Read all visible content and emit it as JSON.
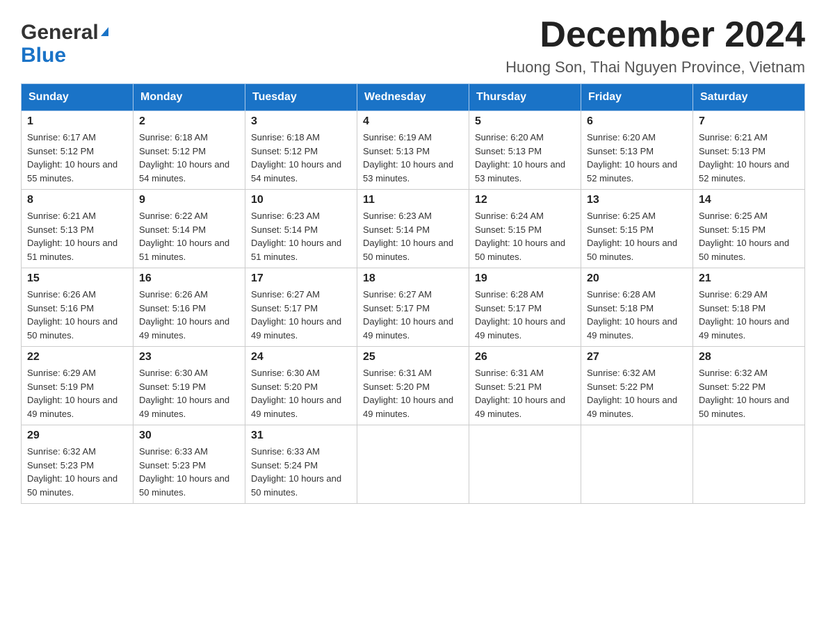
{
  "header": {
    "logo_general": "General",
    "logo_blue": "Blue",
    "month_title": "December 2024",
    "location": "Huong Son, Thai Nguyen Province, Vietnam"
  },
  "weekdays": [
    "Sunday",
    "Monday",
    "Tuesday",
    "Wednesday",
    "Thursday",
    "Friday",
    "Saturday"
  ],
  "weeks": [
    [
      {
        "day": "1",
        "sunrise": "6:17 AM",
        "sunset": "5:12 PM",
        "daylight": "10 hours and 55 minutes."
      },
      {
        "day": "2",
        "sunrise": "6:18 AM",
        "sunset": "5:12 PM",
        "daylight": "10 hours and 54 minutes."
      },
      {
        "day": "3",
        "sunrise": "6:18 AM",
        "sunset": "5:12 PM",
        "daylight": "10 hours and 54 minutes."
      },
      {
        "day": "4",
        "sunrise": "6:19 AM",
        "sunset": "5:13 PM",
        "daylight": "10 hours and 53 minutes."
      },
      {
        "day": "5",
        "sunrise": "6:20 AM",
        "sunset": "5:13 PM",
        "daylight": "10 hours and 53 minutes."
      },
      {
        "day": "6",
        "sunrise": "6:20 AM",
        "sunset": "5:13 PM",
        "daylight": "10 hours and 52 minutes."
      },
      {
        "day": "7",
        "sunrise": "6:21 AM",
        "sunset": "5:13 PM",
        "daylight": "10 hours and 52 minutes."
      }
    ],
    [
      {
        "day": "8",
        "sunrise": "6:21 AM",
        "sunset": "5:13 PM",
        "daylight": "10 hours and 51 minutes."
      },
      {
        "day": "9",
        "sunrise": "6:22 AM",
        "sunset": "5:14 PM",
        "daylight": "10 hours and 51 minutes."
      },
      {
        "day": "10",
        "sunrise": "6:23 AM",
        "sunset": "5:14 PM",
        "daylight": "10 hours and 51 minutes."
      },
      {
        "day": "11",
        "sunrise": "6:23 AM",
        "sunset": "5:14 PM",
        "daylight": "10 hours and 50 minutes."
      },
      {
        "day": "12",
        "sunrise": "6:24 AM",
        "sunset": "5:15 PM",
        "daylight": "10 hours and 50 minutes."
      },
      {
        "day": "13",
        "sunrise": "6:25 AM",
        "sunset": "5:15 PM",
        "daylight": "10 hours and 50 minutes."
      },
      {
        "day": "14",
        "sunrise": "6:25 AM",
        "sunset": "5:15 PM",
        "daylight": "10 hours and 50 minutes."
      }
    ],
    [
      {
        "day": "15",
        "sunrise": "6:26 AM",
        "sunset": "5:16 PM",
        "daylight": "10 hours and 50 minutes."
      },
      {
        "day": "16",
        "sunrise": "6:26 AM",
        "sunset": "5:16 PM",
        "daylight": "10 hours and 49 minutes."
      },
      {
        "day": "17",
        "sunrise": "6:27 AM",
        "sunset": "5:17 PM",
        "daylight": "10 hours and 49 minutes."
      },
      {
        "day": "18",
        "sunrise": "6:27 AM",
        "sunset": "5:17 PM",
        "daylight": "10 hours and 49 minutes."
      },
      {
        "day": "19",
        "sunrise": "6:28 AM",
        "sunset": "5:17 PM",
        "daylight": "10 hours and 49 minutes."
      },
      {
        "day": "20",
        "sunrise": "6:28 AM",
        "sunset": "5:18 PM",
        "daylight": "10 hours and 49 minutes."
      },
      {
        "day": "21",
        "sunrise": "6:29 AM",
        "sunset": "5:18 PM",
        "daylight": "10 hours and 49 minutes."
      }
    ],
    [
      {
        "day": "22",
        "sunrise": "6:29 AM",
        "sunset": "5:19 PM",
        "daylight": "10 hours and 49 minutes."
      },
      {
        "day": "23",
        "sunrise": "6:30 AM",
        "sunset": "5:19 PM",
        "daylight": "10 hours and 49 minutes."
      },
      {
        "day": "24",
        "sunrise": "6:30 AM",
        "sunset": "5:20 PM",
        "daylight": "10 hours and 49 minutes."
      },
      {
        "day": "25",
        "sunrise": "6:31 AM",
        "sunset": "5:20 PM",
        "daylight": "10 hours and 49 minutes."
      },
      {
        "day": "26",
        "sunrise": "6:31 AM",
        "sunset": "5:21 PM",
        "daylight": "10 hours and 49 minutes."
      },
      {
        "day": "27",
        "sunrise": "6:32 AM",
        "sunset": "5:22 PM",
        "daylight": "10 hours and 49 minutes."
      },
      {
        "day": "28",
        "sunrise": "6:32 AM",
        "sunset": "5:22 PM",
        "daylight": "10 hours and 50 minutes."
      }
    ],
    [
      {
        "day": "29",
        "sunrise": "6:32 AM",
        "sunset": "5:23 PM",
        "daylight": "10 hours and 50 minutes."
      },
      {
        "day": "30",
        "sunrise": "6:33 AM",
        "sunset": "5:23 PM",
        "daylight": "10 hours and 50 minutes."
      },
      {
        "day": "31",
        "sunrise": "6:33 AM",
        "sunset": "5:24 PM",
        "daylight": "10 hours and 50 minutes."
      },
      null,
      null,
      null,
      null
    ]
  ]
}
